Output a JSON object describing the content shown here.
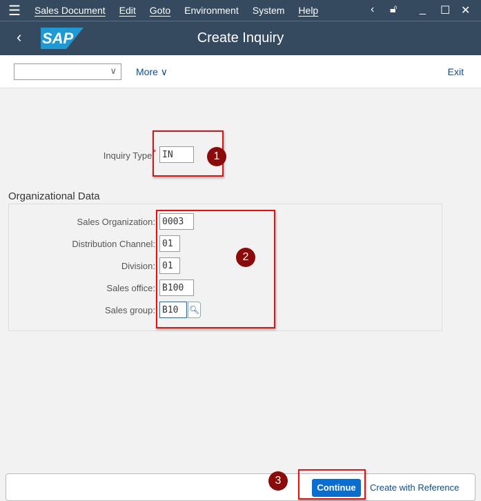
{
  "menu": {
    "items": [
      "Sales Document",
      "Edit",
      "Goto",
      "Environment",
      "System",
      "Help"
    ]
  },
  "header": {
    "title": "Create Inquiry",
    "logo": "SAP"
  },
  "toolbar": {
    "more": "More",
    "exit": "Exit"
  },
  "form": {
    "inquiry_type_label": "Inquiry Type:",
    "inquiry_type": "IN",
    "section": "Organizational Data",
    "fields": [
      {
        "label": "Sales Organization:",
        "value": "0003"
      },
      {
        "label": "Distribution Channel:",
        "value": "01"
      },
      {
        "label": "Division:",
        "value": "01"
      },
      {
        "label": "Sales office:",
        "value": "B100"
      },
      {
        "label": "Sales group:",
        "value": "B10"
      }
    ]
  },
  "badges": [
    "1",
    "2",
    "3"
  ],
  "footer": {
    "continue": "Continue",
    "create_ref": "Create with Reference"
  }
}
